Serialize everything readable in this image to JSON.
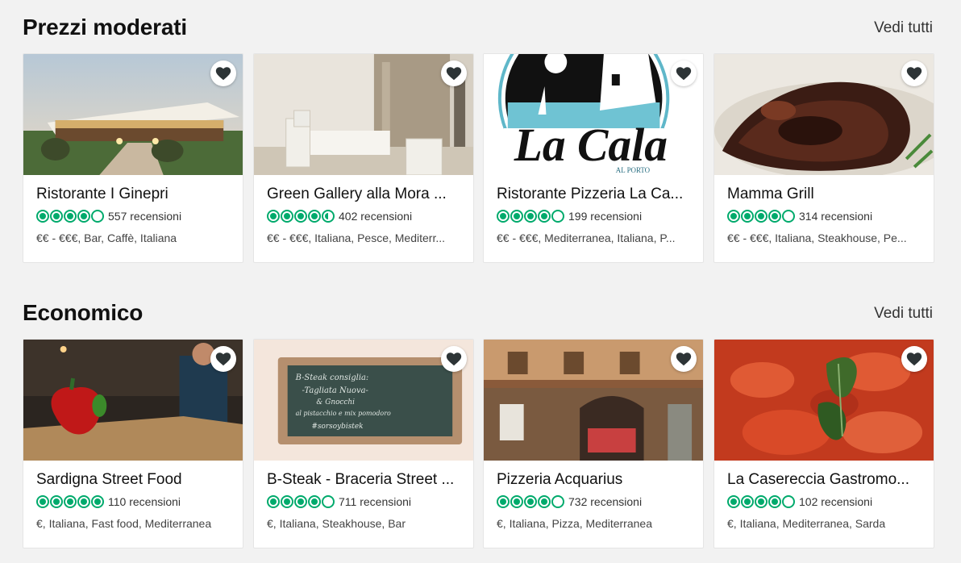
{
  "sections": [
    {
      "title": "Prezzi moderati",
      "see_all": "Vedi tutti",
      "cards": [
        {
          "name": "Ristorante I Ginepri",
          "rating": 4,
          "reviews": "557 recensioni",
          "cuisine": "€€ - €€€, Bar, Caffè, Italiana"
        },
        {
          "name": "Green Gallery alla Mora ...",
          "rating": 4.5,
          "reviews": "402 recensioni",
          "cuisine": "€€ - €€€, Italiana, Pesce, Mediterr..."
        },
        {
          "name": "Ristorante Pizzeria La Ca...",
          "rating": 4,
          "reviews": "199 recensioni",
          "cuisine": "€€ - €€€, Mediterranea, Italiana, P..."
        },
        {
          "name": "Mamma Grill",
          "rating": 4,
          "reviews": "314 recensioni",
          "cuisine": "€€ - €€€, Italiana, Steakhouse, Pe..."
        }
      ]
    },
    {
      "title": "Economico",
      "see_all": "Vedi tutti",
      "cards": [
        {
          "name": "Sardigna Street Food",
          "rating": 5,
          "reviews": "110 recensioni",
          "cuisine": "€, Italiana, Fast food, Mediterranea"
        },
        {
          "name": "B-Steak - Braceria Street ...",
          "rating": 4,
          "reviews": "711 recensioni",
          "cuisine": "€, Italiana, Steakhouse, Bar"
        },
        {
          "name": "Pizzeria Acquarius",
          "rating": 4,
          "reviews": "732 recensioni",
          "cuisine": "€, Italiana, Pizza, Mediterranea"
        },
        {
          "name": "La Casereccia Gastromo...",
          "rating": 4,
          "reviews": "102 recensioni",
          "cuisine": "€, Italiana, Mediterranea, Sarda"
        }
      ]
    }
  ],
  "logo_text": {
    "la_cala": "La Cala",
    "al_porto": "AL PORTO"
  },
  "chalkboard_text": {
    "line1": "B-Steak consiglia:",
    "line2": "-Tagliata Nuova-",
    "line3": "& Gnocchi",
    "line4": "al pistacchio e mix pomodoro",
    "line5": "#sorsoybistek"
  },
  "colors": {
    "rating_green": "#00aa6c",
    "background": "#f2f2f2",
    "heart_fill": "#2d3436"
  },
  "icons": {
    "favorite": "heart-icon",
    "rating": "rating-bubble-icon"
  }
}
